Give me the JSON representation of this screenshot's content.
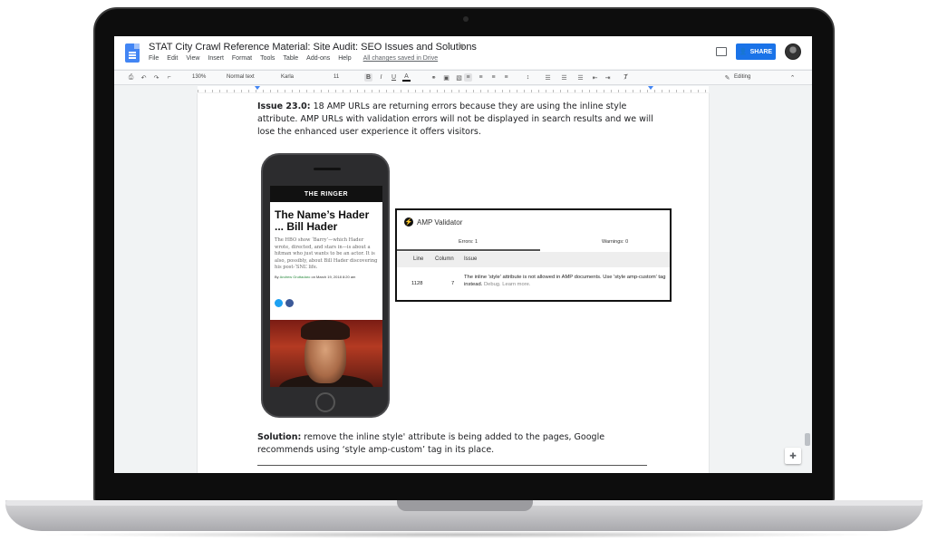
{
  "document": {
    "title": "STAT City Crawl Reference Material: Site Audit: SEO Issues and Solutions",
    "star_icon": "star-outline-icon",
    "folder_icon": "folder-icon",
    "saved_status": "All changes saved in Drive"
  },
  "menu": [
    "File",
    "Edit",
    "View",
    "Insert",
    "Format",
    "Tools",
    "Table",
    "Add-ons",
    "Help"
  ],
  "header": {
    "share_label": "SHARE"
  },
  "toolbar": {
    "zoom": "130%",
    "style": "Normal text",
    "font": "Karla",
    "font_size": "11",
    "bold": "B",
    "italic": "I",
    "underline": "U",
    "text_color": "A",
    "mode": "Editing"
  },
  "content": {
    "issue_label": "Issue 23.0:",
    "issue_text": " 18 AMP URLs are returning errors because they are using the inline style attribute. AMP URLs with validation errors will not be displayed in search results and we will lose the enhanced user experience it offers visitors.",
    "solution_label": "Solution:",
    "solution_text": " remove the inline style' attribute is being added to the pages, Google recommends using ‘style amp-custom’ tag in its place."
  },
  "phone_article": {
    "brand": "THE RINGER",
    "title": "The Name’s Hader ... Bill Hader",
    "body": "The HBO show ‘Barry’—which Hader wrote, directed, and stars in—is about a hitman who just wants to be an actor. It is also, possibly, about Bill Hader discovering his post-‘SNL’ life.",
    "byline_prefix": "By ",
    "author": "Andrew Gruttadaro",
    "byline_date": " on March 19, 2018 8:20 am"
  },
  "validator": {
    "title": "AMP Validator",
    "errors_tab": "Errors: 1",
    "warnings_tab": "Warnings: 0",
    "columns": [
      "Line",
      "Column",
      "Issue"
    ],
    "row": {
      "line": "1128",
      "column": "7",
      "issue": "The inline 'style' attribute is not allowed in AMP documents. Use 'style amp-custom' tag instead.",
      "links": "Debug. Learn more."
    }
  },
  "colors": {
    "accent": "#1a73e8",
    "docs_blue": "#4285f4"
  }
}
